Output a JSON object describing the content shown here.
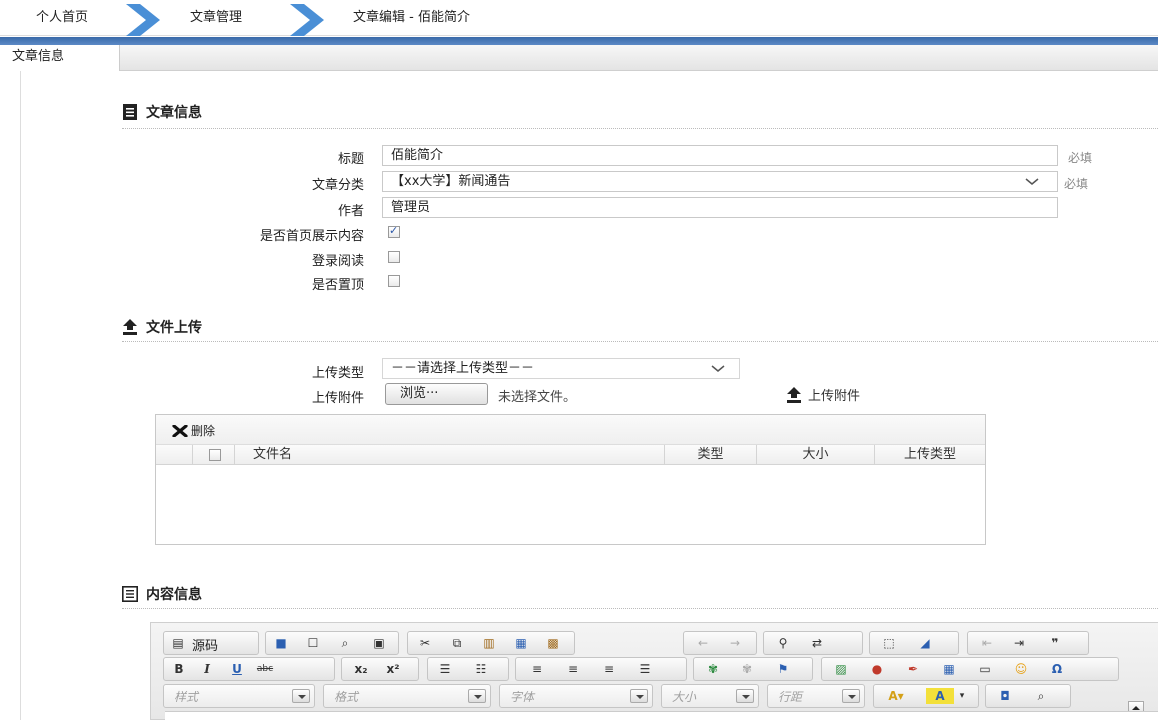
{
  "breadcrumb": {
    "home": "个人首页",
    "article_mgmt": "文章管理",
    "current": "文章编辑 - 佰能简介"
  },
  "tab": {
    "label": "文章信息"
  },
  "sections": {
    "info": "文章信息",
    "upload": "文件上传",
    "content": "内容信息"
  },
  "form": {
    "title_label": "标题",
    "title_value": "佰能简介",
    "required": "必填",
    "category_label": "文章分类",
    "category_value": "【xx大学】新闻通告",
    "author_label": "作者",
    "author_value": "管理员",
    "homepage_label": "是否首页展示内容",
    "homepage_checked": true,
    "login_label": "登录阅读",
    "login_checked": false,
    "top_label": "是否置顶",
    "top_checked": false
  },
  "upload": {
    "type_label": "上传类型",
    "type_placeholder": "－－请选择上传类型－－",
    "file_label": "上传附件",
    "browse_button": "浏览···",
    "no_file": "未选择文件。",
    "upload_button": "上传附件"
  },
  "grid": {
    "delete": "删除",
    "columns": [
      "文件名",
      "类型",
      "大小",
      "上传类型"
    ]
  },
  "editor": {
    "source": "源码",
    "combos": [
      "样式",
      "格式",
      "字体",
      "大小",
      "行距"
    ]
  },
  "colors": {
    "accent": "#3a6aa9",
    "crumb_chevron": "#4a8fd6"
  }
}
